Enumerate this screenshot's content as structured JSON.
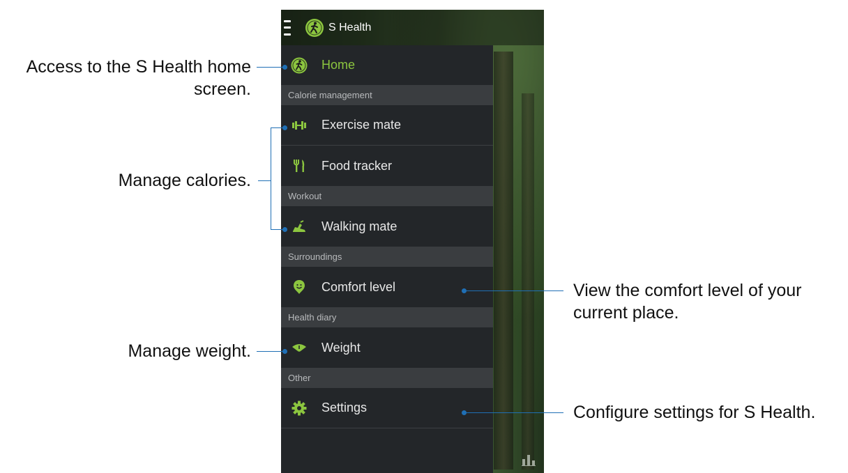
{
  "app": {
    "title": "S Health"
  },
  "drawer": {
    "home_label": "Home",
    "sections": {
      "calorie": "Calorie management",
      "workout": "Workout",
      "surroundings": "Surroundings",
      "health_diary": "Health diary",
      "other": "Other"
    },
    "items": {
      "exercise": "Exercise mate",
      "food": "Food tracker",
      "walking": "Walking mate",
      "comfort": "Comfort level",
      "weight": "Weight",
      "settings": "Settings"
    }
  },
  "callouts": {
    "home_line1": "Access to the S Health home",
    "home_line2": "screen.",
    "calories": "Manage calories.",
    "comfort_line1": "View the comfort level of your",
    "comfort_line2": "current place.",
    "weight": "Manage weight.",
    "settings": "Configure settings for S Health."
  },
  "colors": {
    "accent": "#8cc63f",
    "callout_line": "#1f6fb5"
  }
}
